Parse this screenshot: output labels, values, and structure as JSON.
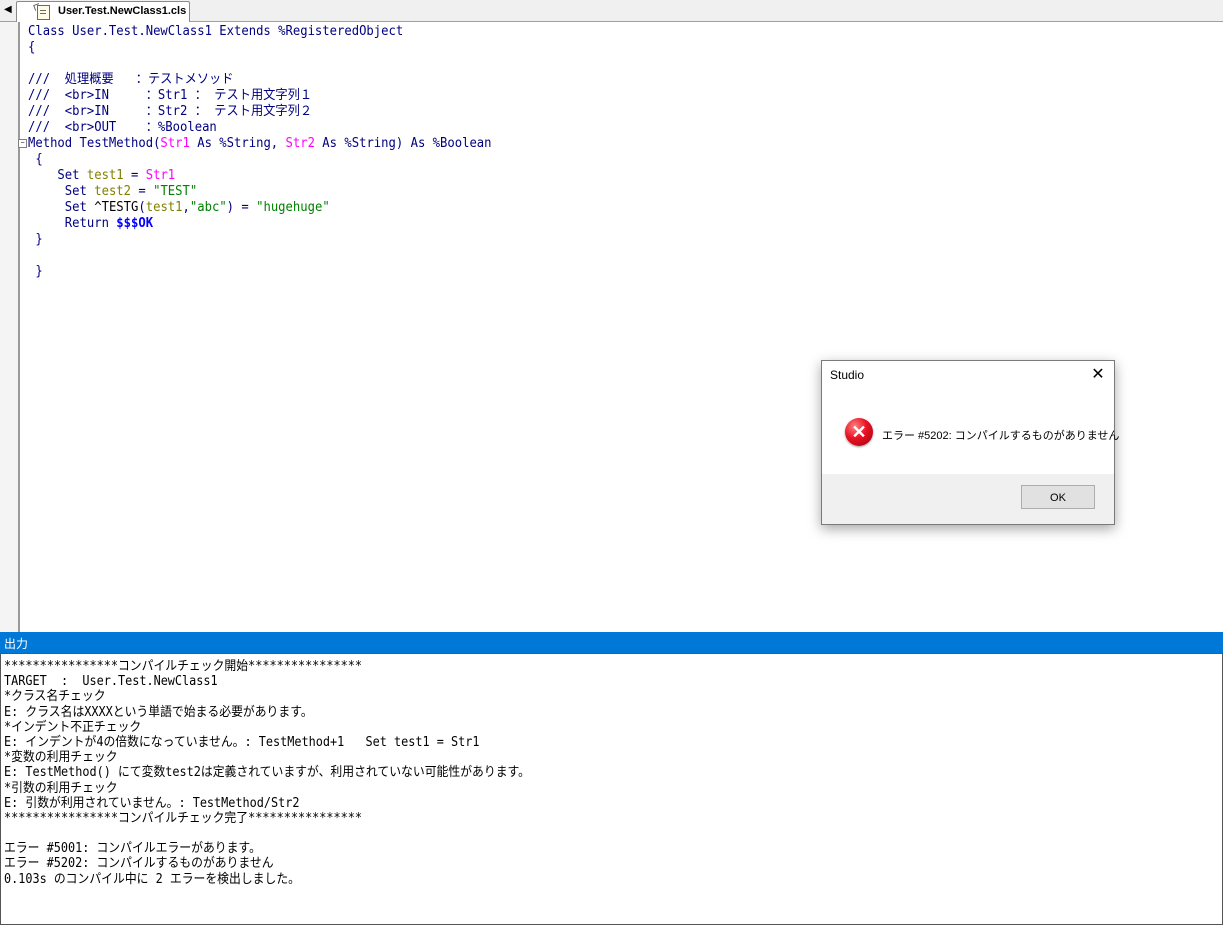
{
  "tab": {
    "label": "User.Test.NewClass1.cls"
  },
  "editor": {
    "lines": [
      [
        {
          "t": "Class User.Test.NewClass1 Extends %RegisteredObject",
          "c": "c-def"
        }
      ],
      [
        {
          "t": "{",
          "c": "c-def"
        }
      ],
      [],
      [
        {
          "t": "///  処理概要   ：テストメソッド",
          "c": "c-cmt"
        }
      ],
      [
        {
          "t": "///  <br>IN     ：Str1 ： テスト用文字列１",
          "c": "c-cmt"
        }
      ],
      [
        {
          "t": "///  <br>IN     ：Str2 ： テスト用文字列２",
          "c": "c-cmt"
        }
      ],
      [
        {
          "t": "///  <br>OUT    ：%Boolean",
          "c": "c-cmt"
        }
      ],
      [
        {
          "t": "Method TestMethod(",
          "c": "c-def"
        },
        {
          "t": "Str1",
          "c": "c-param"
        },
        {
          "t": " As %String, ",
          "c": "c-def"
        },
        {
          "t": "Str2",
          "c": "c-param"
        },
        {
          "t": " As %String) As %Boolean",
          "c": "c-def"
        }
      ],
      [
        {
          "t": " {",
          "c": "c-def"
        }
      ],
      [
        {
          "t": "    Set ",
          "c": "c-def"
        },
        {
          "t": "test1",
          "c": "c-var"
        },
        {
          "t": " = ",
          "c": "c-def"
        },
        {
          "t": "Str1",
          "c": "c-param"
        }
      ],
      [
        {
          "t": "     Set ",
          "c": "c-def"
        },
        {
          "t": "test2",
          "c": "c-var"
        },
        {
          "t": " = ",
          "c": "c-def"
        },
        {
          "t": "\"TEST\"",
          "c": "c-str"
        }
      ],
      [
        {
          "t": "     Set ",
          "c": "c-def"
        },
        {
          "t": "^TESTG",
          "c": "c-glob"
        },
        {
          "t": "(",
          "c": "c-def"
        },
        {
          "t": "test1",
          "c": "c-var"
        },
        {
          "t": ",",
          "c": "c-def"
        },
        {
          "t": "\"abc\"",
          "c": "c-str"
        },
        {
          "t": ") = ",
          "c": "c-def"
        },
        {
          "t": "\"hugehuge\"",
          "c": "c-str"
        }
      ],
      [
        {
          "t": "     Return ",
          "c": "c-def"
        },
        {
          "t": "$$$OK",
          "c": "c-macro"
        }
      ],
      [
        {
          "t": " }",
          "c": "c-def"
        }
      ],
      [],
      [
        {
          "t": " }",
          "c": "c-def"
        }
      ]
    ],
    "fold_marker": "−"
  },
  "output": {
    "title": "出力",
    "lines": [
      "****************コンパイルチェック開始****************",
      "TARGET  :  User.Test.NewClass1",
      "*クラス名チェック",
      "E: クラス名はXXXXという単語で始まる必要があります。",
      "*インデント不正チェック",
      "E: インデントが4の倍数になっていません。: TestMethod+1   Set test1 = Str1",
      "*変数の利用チェック",
      "E: TestMethod() にて変数test2は定義されていますが、利用されていない可能性があります。",
      "*引数の利用チェック",
      "E: 引数が利用されていません。: TestMethod/Str2",
      "****************コンパイルチェック完了****************",
      "",
      "エラー #5001: コンパイルエラーがあります。",
      "エラー #5202: コンパイルするものがありません",
      "0.103s のコンパイル中に 2 エラーを検出しました。"
    ]
  },
  "dialog": {
    "title": "Studio",
    "close_glyph": "✕",
    "icon_glyph": "✕",
    "message": "エラー #5202: コンパイルするものがありません",
    "ok_label": "OK"
  },
  "colors": {
    "output_header": "#0078d7",
    "keyword": "#000080",
    "param": "#ff00ff",
    "variable": "#808000",
    "string": "#008000",
    "macro": "#0000ff",
    "error_icon": "#e81123"
  }
}
